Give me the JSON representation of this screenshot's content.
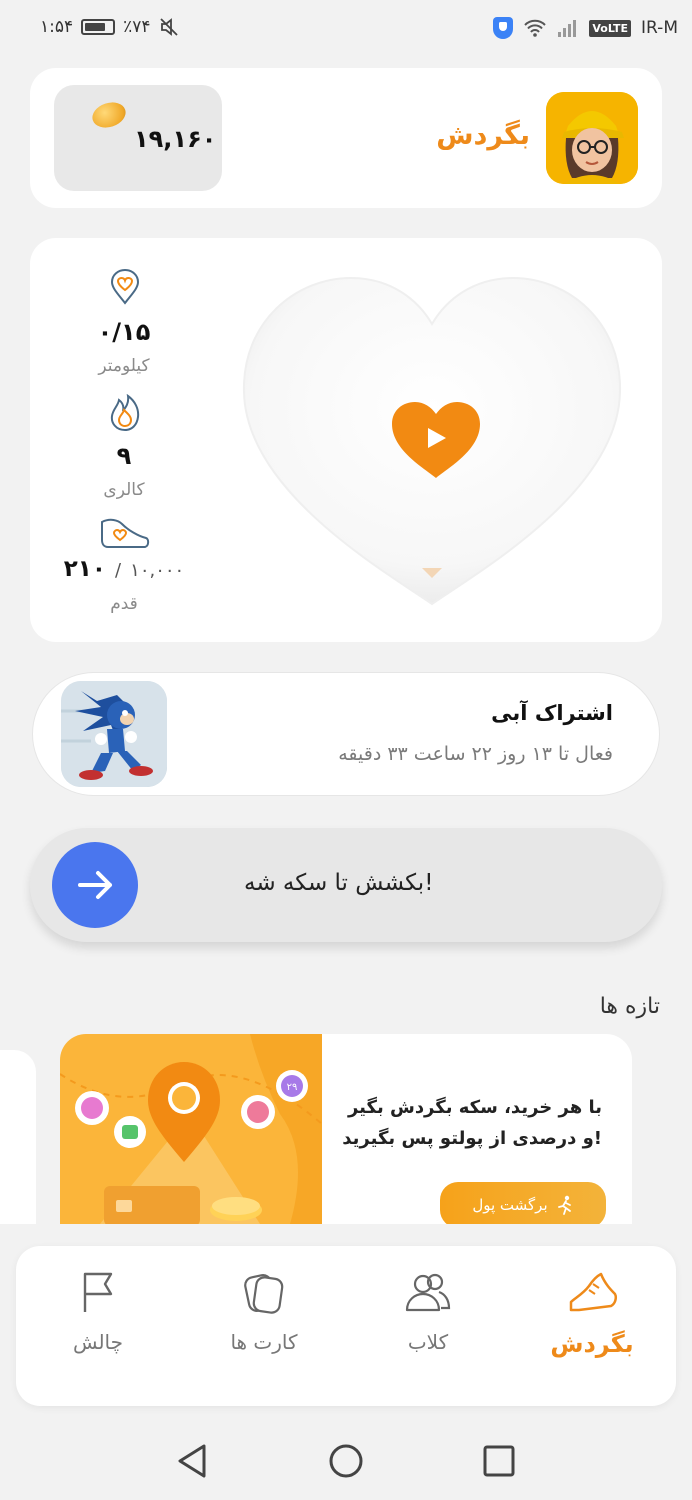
{
  "status_bar": {
    "time": "۱:۵۴",
    "battery": "٪۷۴",
    "carrier": "IR-M",
    "volte": "VoLTE"
  },
  "header": {
    "coins": "۱۹,۱۶۰",
    "brand": "بگردش"
  },
  "activity": {
    "distance_value": "۰/۱۵",
    "distance_label": "کیلومتر",
    "calories_value": "۹",
    "calories_label": "کالری",
    "steps_value": "۲۱۰",
    "steps_separator": "/",
    "steps_goal": "۱۰,۰۰۰",
    "steps_label": "قدم"
  },
  "subscription": {
    "title": "اشتراک آبی",
    "description": "فعال تا ۱۳ روز ۲۲ ساعت ۳۳ دقیقه"
  },
  "swipe": {
    "label": "بکشش تا سکه شه!"
  },
  "news": {
    "title": "تازه ها",
    "promo_text": "با هر خرید، سکه بگردش بگیر و درصدی از پولتو پس بگیرید!",
    "promo_button": "برگشت پول",
    "badge_number": "۲۹"
  },
  "bottom_nav": {
    "items": [
      {
        "label": "بگردش",
        "icon": "shoe-icon",
        "active": true
      },
      {
        "label": "کلاب",
        "icon": "users-icon",
        "active": false
      },
      {
        "label": "کارت ها",
        "icon": "cards-icon",
        "active": false
      },
      {
        "label": "چالش",
        "icon": "flag-icon",
        "active": false
      }
    ]
  },
  "colors": {
    "accent": "#ee8a1a",
    "swipe_button": "#4a76ee",
    "background": "#f2f2f2"
  }
}
